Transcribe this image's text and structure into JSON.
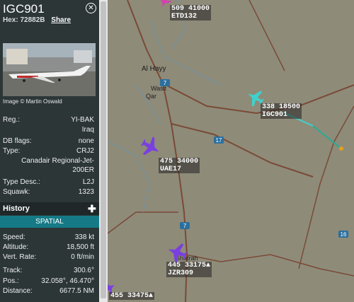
{
  "flight": {
    "callsign": "IGC901",
    "hex_label": "Hex:",
    "hex_value": "72882B",
    "share_label": "Share",
    "close_icon": "close-icon"
  },
  "photo": {
    "credit": "Image © Martin Oswald"
  },
  "details": [
    {
      "label": "Reg.:",
      "value": "YI-BAK"
    },
    {
      "label": "",
      "value": "Iraq"
    },
    {
      "label": "DB flags:",
      "value": "none"
    },
    {
      "label": "Type:",
      "value": "CRJ2"
    },
    {
      "label": "",
      "value": "Canadair Regional-Jet-"
    },
    {
      "label": "",
      "value": "200ER"
    },
    {
      "label": "Type Desc.:",
      "value": "L2J"
    },
    {
      "label": "Squawk:",
      "value": "1323"
    }
  ],
  "history": {
    "title": "History",
    "add_icon": "plus-icon"
  },
  "spatial": {
    "title": "SPATIAL"
  },
  "spatial_rows": [
    {
      "label": "Speed:",
      "value": "338 kt"
    },
    {
      "label": "Altitude:",
      "value": "18,500 ft"
    },
    {
      "label": "Vert. Rate:",
      "value": "0 ft/min"
    },
    {
      "label": "Track:",
      "value": "300.6°"
    },
    {
      "label": "Pos.:",
      "value": "32.058°, 46.470°"
    },
    {
      "label": "Distance:",
      "value": "6677.5 NM"
    }
  ],
  "map": {
    "places": [
      "Al Hayy",
      "Qar",
      "Wasit",
      "Shatrah"
    ],
    "roads": [
      "7",
      "7",
      "7",
      "17",
      "16",
      "17"
    ],
    "aircraft": [
      {
        "line1": "509  41000",
        "line2": "ETD132",
        "color": "#d63fb0"
      },
      {
        "line1": "338  18500",
        "line2": "IGC901",
        "color": "#3fd1cc"
      },
      {
        "line1": "475  34000",
        "line2": "UAE17",
        "color": "#7a3fe0"
      },
      {
        "line1": "445  33175▲",
        "line2": "JZR309",
        "color": "#7a3fe0"
      },
      {
        "line1": "455  33475▲",
        "line2": "",
        "color": "#7a3fe0"
      }
    ]
  }
}
